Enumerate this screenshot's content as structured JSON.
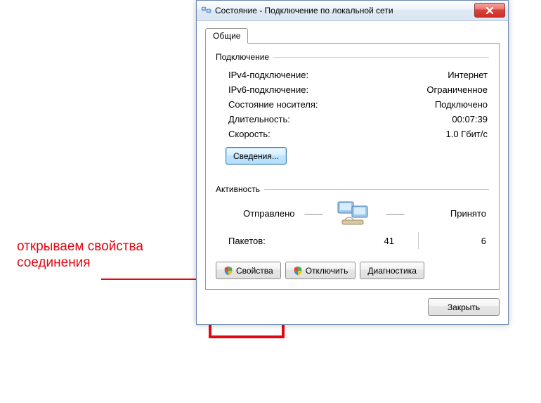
{
  "annotation": {
    "line1": "открываем свойства",
    "line2": "соединения"
  },
  "dialog": {
    "title": "Состояние - Подключение по локальной сети",
    "tabs": {
      "general": "Общие"
    },
    "connection": {
      "header": "Подключение",
      "ipv4_label": "IPv4-подключение:",
      "ipv4_value": "Интернет",
      "ipv6_label": "IPv6-подключение:",
      "ipv6_value": "Ограниченное",
      "media_label": "Состояние носителя:",
      "media_value": "Подключено",
      "duration_label": "Длительность:",
      "duration_value": "00:07:39",
      "speed_label": "Скорость:",
      "speed_value": "1.0 Гбит/с",
      "details_button": "Сведения..."
    },
    "activity": {
      "header": "Активность",
      "sent_label": "Отправлено",
      "recv_label": "Принято",
      "packets_label": "Пакетов:",
      "packets_sent": "41",
      "packets_recv": "6"
    },
    "buttons": {
      "properties": "Свойства",
      "disable": "Отключить",
      "diagnose": "Диагностика",
      "close": "Закрыть"
    }
  }
}
